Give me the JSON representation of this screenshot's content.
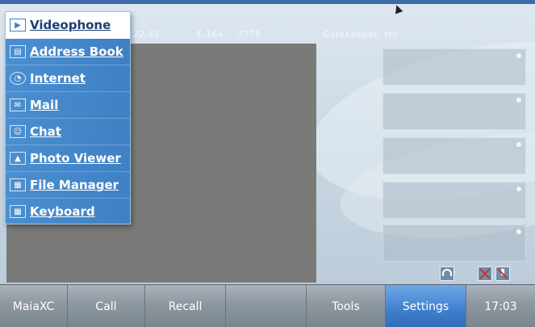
{
  "status": {
    "ip_fragment": "22.48",
    "e164_label": "E.164",
    "e164_number": "3778",
    "gatekeeper": "GateKeeper: Yes"
  },
  "menu": {
    "items": [
      {
        "label": "Videophone",
        "icon": "videophone-icon",
        "active": true
      },
      {
        "label": "Address Book",
        "icon": "address-book-icon"
      },
      {
        "label": "Internet",
        "icon": "internet-icon"
      },
      {
        "label": "Mail",
        "icon": "mail-icon"
      },
      {
        "label": "Chat",
        "icon": "chat-icon"
      },
      {
        "label": "Photo Viewer",
        "icon": "photo-viewer-icon"
      },
      {
        "label": "File Manager",
        "icon": "file-manager-icon"
      },
      {
        "label": "Keyboard",
        "icon": "keyboard-icon"
      }
    ]
  },
  "taskbar": {
    "maiaxc": "MaiaXC",
    "call": "Call",
    "recall": "Recall",
    "blank": "",
    "tools": "Tools",
    "settings": "Settings",
    "clock": "17:03"
  },
  "colors": {
    "menu_bg": "#3f80c4",
    "taskbar_active": "#3f7fcd",
    "video_area": "#7a7a78"
  }
}
